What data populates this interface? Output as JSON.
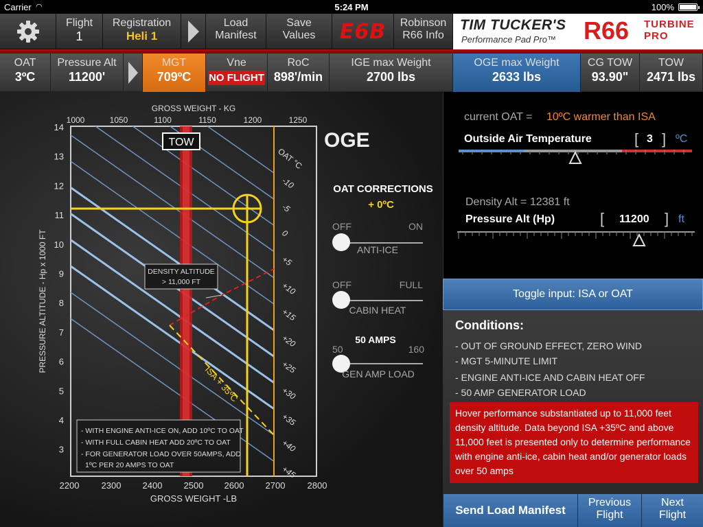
{
  "status": {
    "carrier": "Carrier",
    "time": "5:24 PM",
    "battery": "100%"
  },
  "toolbar": {
    "flight_label": "Flight",
    "flight_value": "1",
    "registration_label": "Registration",
    "registration_value": "Heli 1",
    "load_l1": "Load",
    "load_l2": "Manifest",
    "save_l1": "Save",
    "save_l2": "Values",
    "e6b": "E6B",
    "robinson_l1": "Robinson",
    "robinson_l2": "R66 Info"
  },
  "brand": {
    "line1": "TIM TUCKER'S",
    "line2": "Performance Pad Pro™",
    "model": "R66",
    "turbine": "TURBINE",
    "pro": "PRO"
  },
  "datarow": {
    "oat_label": "OAT",
    "oat_value": "3ºC",
    "palt_label": "Pressure Alt",
    "palt_value": "11200'",
    "mgt_label": "MGT",
    "mgt_value": "709ºC",
    "vne_label": "Vne",
    "vne_value": "NO FLIGHT",
    "roc_label": "RoC",
    "roc_value": "898'/min",
    "ige_label": "IGE max Weight",
    "ige_value": "2700 lbs",
    "oge_label": "OGE max Weight",
    "oge_value": "2633 lbs",
    "cg_label": "CG TOW",
    "cg_value": "93.90\"",
    "tow_label": "TOW",
    "tow_value": "2471 lbs"
  },
  "chart": {
    "title": "OGE",
    "top_axis_title": "GROSS WEIGHT - KG",
    "bottom_axis_title": "GROSS WEIGHT -LB",
    "y_axis_title": "PRESSURE ALTITUDE - Hp x 1000 FT",
    "tow_label": "TOW",
    "oat_axis_title": "OAT °C",
    "density_box_l1": "DENSITY ALTITUDE",
    "density_box_l2": "> 11,000 FT",
    "isa_label": "ISA + 35ºC",
    "kg_ticks": [
      "1000",
      "1050",
      "1100",
      "1150",
      "1200",
      "1250"
    ],
    "lb_ticks": [
      "2200",
      "2300",
      "2400",
      "2500",
      "2600",
      "2700",
      "2800"
    ],
    "y_ticks": [
      "14",
      "13",
      "12",
      "11",
      "10",
      "9",
      "8",
      "7",
      "6",
      "5",
      "4",
      "3"
    ],
    "oat_ticks": [
      "-10",
      "-5",
      "0",
      "+5",
      "+10",
      "+15",
      "+20",
      "+25",
      "+30",
      "+35",
      "+40",
      "+45"
    ],
    "notes": [
      "- WITH ENGINE ANTI-ICE ON, ADD 10ºC TO OAT",
      "- WITH FULL CABIN HEAT ADD 20ºC TO OAT",
      "- FOR GENERATOR LOAD OVER 50AMPS, ADD",
      "  1ºC PER 20 AMPS TO OAT"
    ],
    "colors": {
      "redband": "#c01818",
      "yellow": "#f5d31a",
      "orange": "#f0a020",
      "line": "#7fa8d6"
    }
  },
  "corrections": {
    "title": "OAT CORRECTIONS",
    "value": "+ 0ºC",
    "antiice_off": "OFF",
    "antiice_on": "ON",
    "antiice_label": "ANTI-ICE",
    "cabin_off": "OFF",
    "cabin_full": "FULL",
    "cabin_label": "CABIN HEAT",
    "amps_title": "50 AMPS",
    "amps_min": "50",
    "amps_max": "160",
    "amps_label": "GEN AMP LOAD"
  },
  "oatpanel": {
    "current_label": "current OAT =",
    "current_value": "10ºC warmer than ISA",
    "oat_title": "Outside Air Temperature",
    "oat_open": "[",
    "oat_input": "3",
    "oat_close": "]",
    "oat_unit": "ºC",
    "density_text": "Density Alt = 12381 ft",
    "palt_title": "Pressure Alt (Hp)",
    "palt_open": "[",
    "palt_input": "11200",
    "palt_close": "]",
    "palt_unit": "ft"
  },
  "toggle_label": "Toggle input: ISA or OAT",
  "conditions": {
    "title": "Conditions:",
    "items": [
      "- OUT OF GROUND EFFECT, ZERO WIND",
      "- MGT 5-MINUTE LIMIT",
      "- ENGINE ANTI-ICE AND CABIN HEAT OFF",
      "- 50 AMP GENERATOR LOAD"
    ],
    "warning": "Hover performance substantiated up to 11,000 feet density altitude. Data beyond ISA +35ºC and above 11,000 feet is presented only to determine performance with engine anti-ice, cabin heat and/or generator loads over 50 amps"
  },
  "bottom": {
    "send": "Send Load Manifest",
    "prev_l1": "Previous",
    "prev_l2": "Flight",
    "next_l1": "Next",
    "next_l2": "Flight"
  }
}
